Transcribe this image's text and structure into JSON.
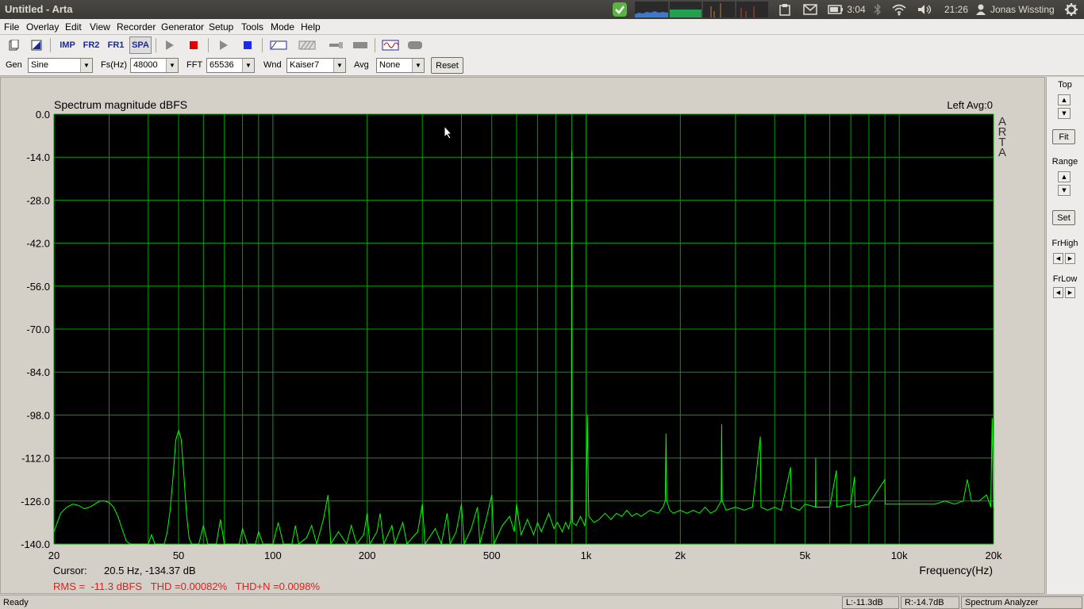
{
  "window": {
    "title": "Untitled - Arta"
  },
  "indicators": {
    "battery_time": "3:04",
    "clock": "21:26",
    "user": "Jonas Wissting"
  },
  "menu": [
    "File",
    "Overlay",
    "Edit",
    "View",
    "Recorder",
    "Generator",
    "Setup",
    "Tools",
    "Mode",
    "Help"
  ],
  "toolbar": {
    "imp_label": "IMP",
    "fr2_label": "FR2",
    "fr1_label": "FR1",
    "spa_label": "SPA"
  },
  "options": {
    "gen_label": "Gen",
    "gen_value": "Sine",
    "fs_label": "Fs(Hz)",
    "fs_value": "48000",
    "fft_label": "FFT",
    "fft_value": "65536",
    "wnd_label": "Wnd",
    "wnd_value": "Kaiser7",
    "avg_label": "Avg",
    "avg_value": "None",
    "reset_label": "Reset"
  },
  "side": {
    "top_label": "Top",
    "fit_label": "Fit",
    "range_label": "Range",
    "set_label": "Set",
    "frhigh_label": "FrHigh",
    "frlow_label": "FrLow"
  },
  "readout": {
    "cursor_label": "Cursor:",
    "cursor_value": "20.5 Hz, -134.37 dB",
    "stats": "RMS =  -11.3 dBFS   THD =0.00082%   THD+N =0.0098%"
  },
  "status": {
    "ready": "Ready",
    "left": "L:-11.3dB",
    "right": "R:-14.7dB",
    "mode": "Spectrum Analyzer"
  },
  "colors": {
    "trace": "#00ff00",
    "grid": "#00a000",
    "background": "#000000",
    "stats_text": "#e02020"
  },
  "chart_data": {
    "type": "line",
    "title": "Spectrum magnitude dBFS",
    "channel_info": "Left  Avg:0",
    "watermark": "ARTA",
    "xlabel": "Frequency(Hz)",
    "x_scale": "log",
    "xlim": [
      20,
      20000
    ],
    "ylim": [
      -140,
      0
    ],
    "y_ticks": [
      "0.0",
      "-14.0",
      "-28.0",
      "-42.0",
      "-56.0",
      "-70.0",
      "-84.0",
      "-98.0",
      "-112.0",
      "-126.0",
      "-140.0"
    ],
    "x_ticks": [
      {
        "label": "20",
        "value": 20
      },
      {
        "label": "50",
        "value": 50
      },
      {
        "label": "100",
        "value": 100
      },
      {
        "label": "200",
        "value": 200
      },
      {
        "label": "500",
        "value": 500
      },
      {
        "label": "1k",
        "value": 1000
      },
      {
        "label": "2k",
        "value": 2000
      },
      {
        "label": "5k",
        "value": 5000
      },
      {
        "label": "10k",
        "value": 10000
      },
      {
        "label": "20k",
        "value": 20000
      }
    ],
    "grid": true,
    "series": [
      {
        "points": [
          [
            20,
            -136
          ],
          [
            21,
            -130
          ],
          [
            22,
            -128
          ],
          [
            23,
            -127
          ],
          [
            24,
            -127.5
          ],
          [
            25,
            -128.5
          ],
          [
            26,
            -128
          ],
          [
            27,
            -127
          ],
          [
            28,
            -126
          ],
          [
            29,
            -126
          ],
          [
            30,
            -126.5
          ],
          [
            31,
            -128
          ],
          [
            32,
            -131
          ],
          [
            33,
            -135
          ],
          [
            34,
            -139
          ],
          [
            35,
            -140
          ],
          [
            40,
            -140
          ],
          [
            41,
            -137
          ],
          [
            42,
            -140
          ],
          [
            45,
            -140
          ],
          [
            46,
            -136
          ],
          [
            47,
            -129
          ],
          [
            48,
            -118
          ],
          [
            49,
            -106
          ],
          [
            50,
            -103
          ],
          [
            51,
            -106
          ],
          [
            52,
            -118
          ],
          [
            53,
            -130
          ],
          [
            54,
            -138
          ],
          [
            55,
            -140
          ],
          [
            58,
            -140
          ],
          [
            60,
            -134
          ],
          [
            62,
            -140
          ],
          [
            66,
            -140
          ],
          [
            68,
            -132
          ],
          [
            70,
            -140
          ],
          [
            78,
            -140
          ],
          [
            80,
            -135
          ],
          [
            83,
            -140
          ],
          [
            88,
            -140
          ],
          [
            90,
            -136
          ],
          [
            93,
            -140
          ],
          [
            100,
            -140
          ],
          [
            104,
            -133
          ],
          [
            108,
            -140
          ],
          [
            115,
            -140
          ],
          [
            118,
            -134
          ],
          [
            121,
            -140
          ],
          [
            128,
            -138
          ],
          [
            133,
            -134
          ],
          [
            138,
            -140
          ],
          [
            145,
            -132
          ],
          [
            150,
            -124
          ],
          [
            153,
            -140
          ],
          [
            162,
            -136
          ],
          [
            172,
            -140
          ],
          [
            178,
            -134
          ],
          [
            185,
            -140
          ],
          [
            195,
            -137
          ],
          [
            200,
            -130
          ],
          [
            204,
            -140
          ],
          [
            215,
            -136
          ],
          [
            220,
            -130
          ],
          [
            226,
            -140
          ],
          [
            240,
            -134
          ],
          [
            245,
            -140
          ],
          [
            260,
            -133
          ],
          [
            268,
            -140
          ],
          [
            290,
            -136
          ],
          [
            300,
            -127
          ],
          [
            306,
            -140
          ],
          [
            330,
            -135
          ],
          [
            345,
            -140
          ],
          [
            360,
            -130
          ],
          [
            368,
            -140
          ],
          [
            385,
            -136
          ],
          [
            400,
            -127
          ],
          [
            408,
            -140
          ],
          [
            430,
            -135
          ],
          [
            450,
            -128
          ],
          [
            458,
            -140
          ],
          [
            480,
            -132
          ],
          [
            500,
            -124
          ],
          [
            508,
            -140
          ],
          [
            540,
            -134
          ],
          [
            570,
            -131
          ],
          [
            590,
            -136
          ],
          [
            600,
            -127
          ],
          [
            620,
            -137
          ],
          [
            650,
            -132
          ],
          [
            680,
            -137
          ],
          [
            700,
            -133
          ],
          [
            720,
            -136
          ],
          [
            760,
            -130
          ],
          [
            790,
            -135
          ],
          [
            810,
            -133
          ],
          [
            840,
            -136
          ],
          [
            860,
            -133
          ],
          [
            880,
            -135
          ],
          [
            895,
            -132
          ],
          [
            898,
            -112
          ],
          [
            900,
            -12
          ],
          [
            902,
            -112
          ],
          [
            906,
            -133
          ],
          [
            930,
            -134
          ],
          [
            960,
            -131
          ],
          [
            990,
            -134
          ],
          [
            1000,
            -131
          ],
          [
            1010,
            -98
          ],
          [
            1020,
            -131
          ],
          [
            1060,
            -133
          ],
          [
            1100,
            -132
          ],
          [
            1150,
            -130
          ],
          [
            1200,
            -132
          ],
          [
            1250,
            -130
          ],
          [
            1300,
            -131
          ],
          [
            1350,
            -129
          ],
          [
            1400,
            -131
          ],
          [
            1450,
            -130
          ],
          [
            1500,
            -131
          ],
          [
            1600,
            -129
          ],
          [
            1700,
            -130
          ],
          [
            1760,
            -128
          ],
          [
            1790,
            -126
          ],
          [
            1800,
            -104
          ],
          [
            1810,
            -126
          ],
          [
            1850,
            -129
          ],
          [
            1900,
            -130
          ],
          [
            2000,
            -129
          ],
          [
            2100,
            -130
          ],
          [
            2200,
            -129
          ],
          [
            2300,
            -130
          ],
          [
            2400,
            -128
          ],
          [
            2500,
            -130
          ],
          [
            2600,
            -129
          ],
          [
            2700,
            -126
          ],
          [
            2710,
            -101
          ],
          [
            2720,
            -126
          ],
          [
            2800,
            -129
          ],
          [
            3000,
            -128
          ],
          [
            3200,
            -129
          ],
          [
            3400,
            -128
          ],
          [
            3600,
            -105
          ],
          [
            3620,
            -128
          ],
          [
            3800,
            -129
          ],
          [
            4000,
            -128
          ],
          [
            4200,
            -129
          ],
          [
            4500,
            -115
          ],
          [
            4520,
            -128
          ],
          [
            4800,
            -129
          ],
          [
            5000,
            -127
          ],
          [
            5400,
            -128
          ],
          [
            5410,
            -112
          ],
          [
            5420,
            -128
          ],
          [
            6000,
            -128
          ],
          [
            6300,
            -116
          ],
          [
            6320,
            -128
          ],
          [
            7000,
            -127
          ],
          [
            7200,
            -118
          ],
          [
            7220,
            -128
          ],
          [
            8000,
            -127
          ],
          [
            9000,
            -119
          ],
          [
            9020,
            -127
          ],
          [
            10000,
            -127
          ],
          [
            11000,
            -127
          ],
          [
            12000,
            -127
          ],
          [
            13000,
            -127
          ],
          [
            14000,
            -126
          ],
          [
            15000,
            -127
          ],
          [
            16000,
            -126
          ],
          [
            16500,
            -119
          ],
          [
            17000,
            -126
          ],
          [
            18000,
            -126
          ],
          [
            19000,
            -124
          ],
          [
            19600,
            -128
          ],
          [
            19800,
            -99
          ],
          [
            20000,
            -128
          ]
        ]
      }
    ]
  }
}
